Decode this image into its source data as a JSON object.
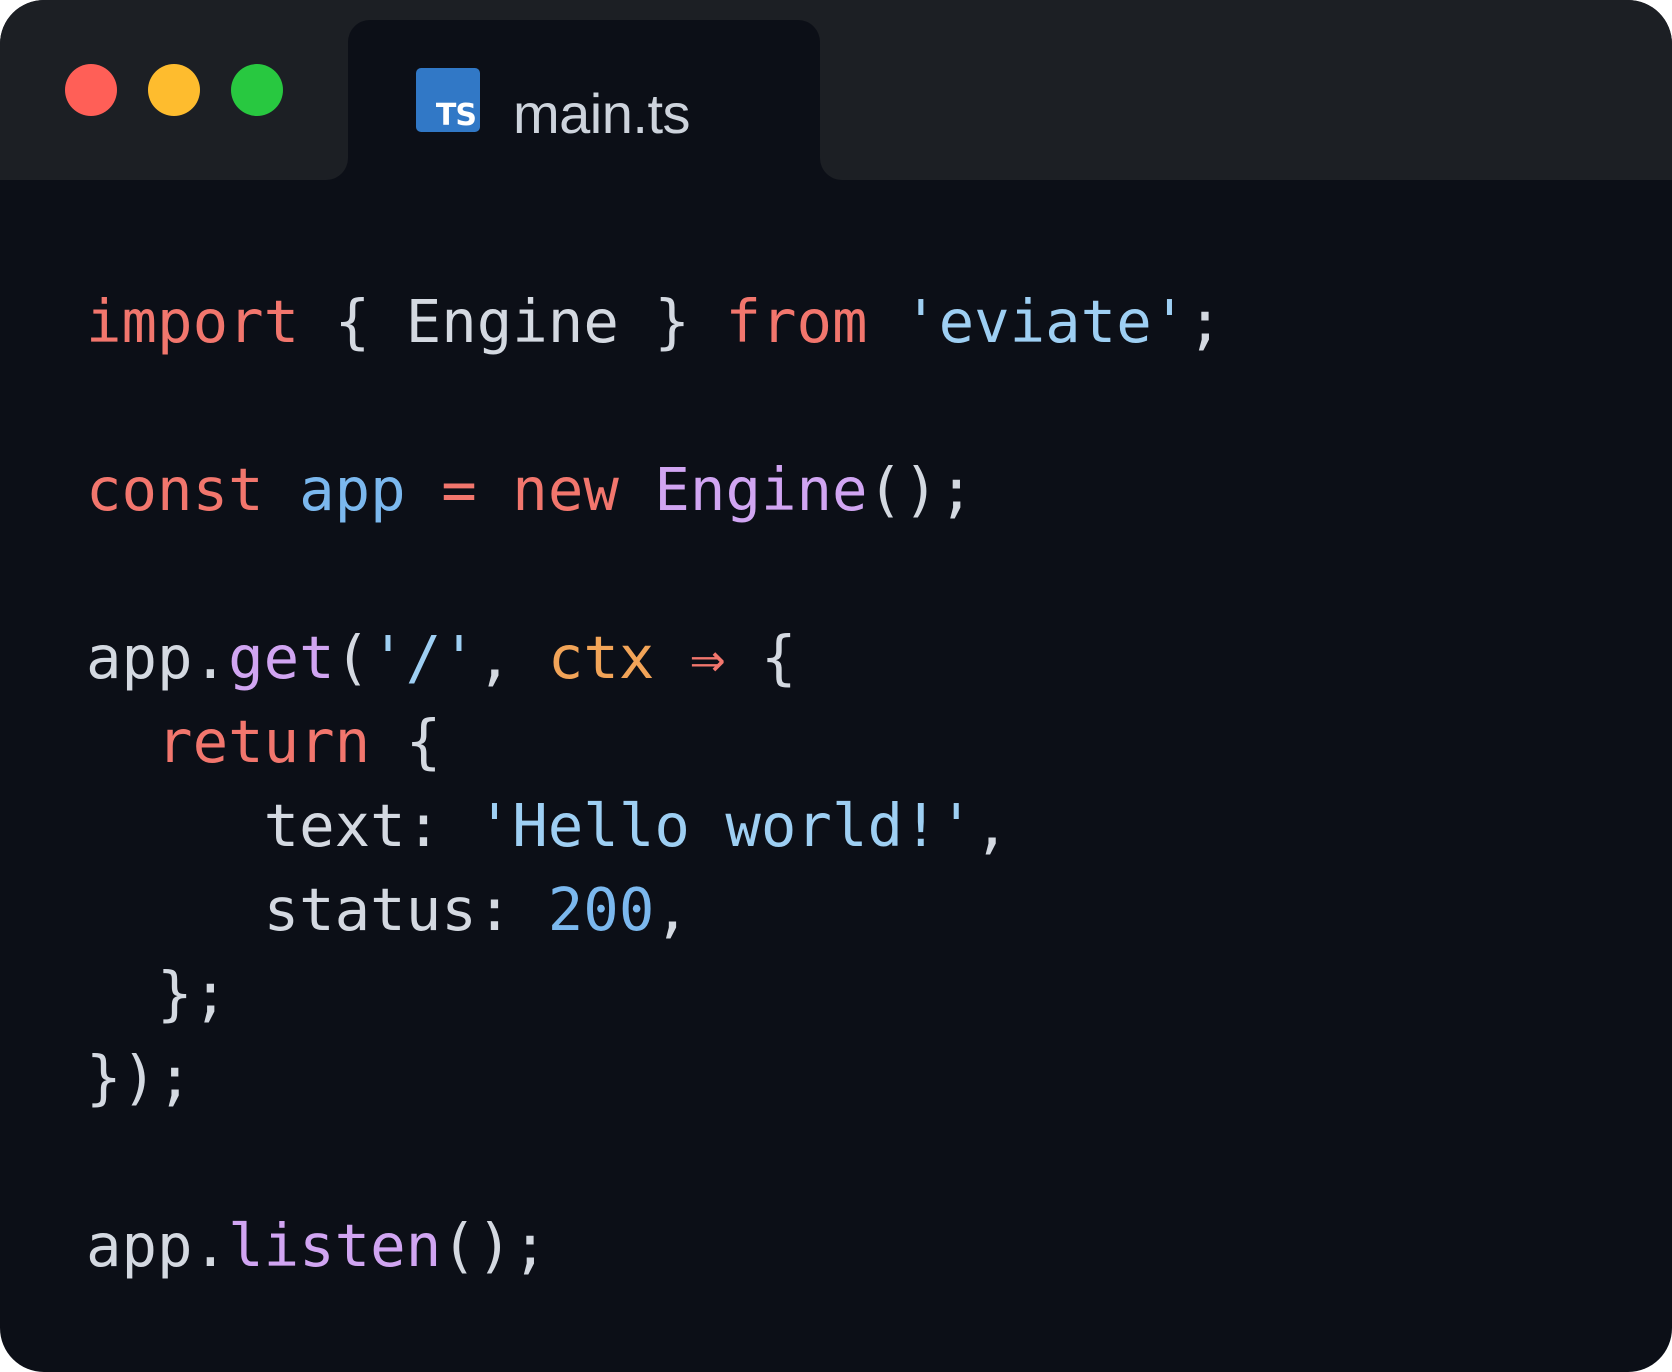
{
  "window": {
    "tab_title": "main.ts",
    "tab_icon_label": "TS",
    "traffic_lights": {
      "close_color": "#ff5f57",
      "minimize_color": "#febc2e",
      "zoom_color": "#28c840"
    }
  },
  "colors": {
    "keyword": "#f2766d",
    "string": "#9ecff3",
    "function": "#d1a5f2",
    "variable": "#7bb8ee",
    "parameter": "#f2a458",
    "number": "#7bb8ee",
    "plain": "#d4d9e1",
    "ts_badge": "#3178c6"
  },
  "code": {
    "l1": {
      "import": "import",
      "brace_open": " { ",
      "engine": "Engine",
      "brace_close": " } ",
      "from": "from",
      "space": " ",
      "module": "'eviate'",
      "semi": ";"
    },
    "l2": {
      "const": "const",
      "space1": " ",
      "app": "app",
      "eq": " = ",
      "new": "new",
      "space2": " ",
      "engine": "Engine",
      "call": "();"
    },
    "l3": {
      "app": "app.",
      "get": "get",
      "open": "(",
      "path": "'/'",
      "comma": ", ",
      "ctx": "ctx",
      "space": " ",
      "arrow": "⇒",
      "brace": " {"
    },
    "l4": {
      "indent": "  ",
      "return": "return",
      "brace": " {"
    },
    "l5": {
      "key": "     text: ",
      "value": "'Hello world!'",
      "comma": ","
    },
    "l6": {
      "key": "     status: ",
      "value": "200",
      "comma": ","
    },
    "l7": {
      "text": "  };"
    },
    "l8": {
      "text": "});"
    },
    "l9": {
      "app": "app.",
      "listen": "listen",
      "call": "();"
    }
  }
}
